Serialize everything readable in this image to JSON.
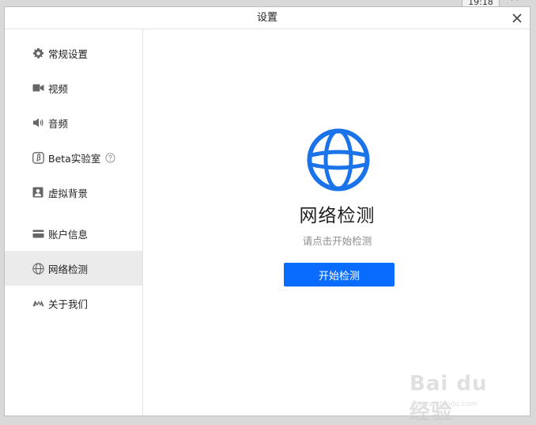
{
  "background": {
    "clock": "19:18",
    "corner_glyph": "⌜⌝"
  },
  "window": {
    "title": "设置"
  },
  "sidebar": {
    "items": [
      {
        "label": "常规设置",
        "icon": "gear-icon"
      },
      {
        "label": "视频",
        "icon": "video-camera-icon"
      },
      {
        "label": "音频",
        "icon": "speaker-icon"
      },
      {
        "label": "Beta实验室",
        "icon": "beta-icon",
        "help_icon": "question-circle-icon"
      },
      {
        "label": "虚拟背景",
        "icon": "portrait-icon"
      },
      {
        "label": "账户信息",
        "icon": "card-icon"
      },
      {
        "label": "网络检测",
        "icon": "globe-icon",
        "active": true
      },
      {
        "label": "关于我们",
        "icon": "logo-icon"
      }
    ]
  },
  "main": {
    "title": "网络检测",
    "subtitle": "请点击开始检测",
    "button_label": "开始检测"
  },
  "watermark": {
    "text": "Bai du 经验",
    "url": "jingyan.baidu.com"
  },
  "colors": {
    "accent": "#0a6cff",
    "active_bg": "#ebebeb",
    "globe": "#1a73e8"
  }
}
